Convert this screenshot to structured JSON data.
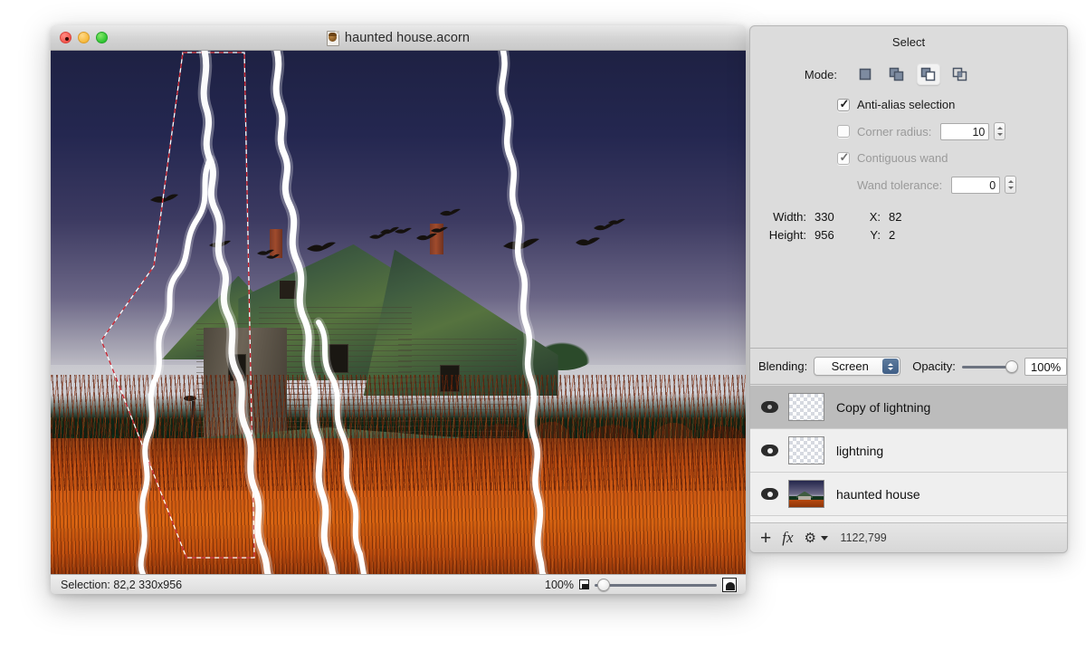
{
  "window": {
    "title": "haunted house.acorn",
    "doc_icon": "acorn-document-icon",
    "controls": {
      "close": "close-button",
      "minimize": "minimize-button",
      "zoom": "zoom-button"
    }
  },
  "statusbar": {
    "selection_text": "Selection: 82,2 330x956",
    "zoom_percent": "100%",
    "small_icon": "small-image-icon",
    "large_icon": "large-image-icon"
  },
  "inspector": {
    "title": "Select",
    "mode": {
      "label": "Mode:",
      "options": [
        {
          "name": "new-selection",
          "selected": false
        },
        {
          "name": "add-to-selection",
          "selected": false
        },
        {
          "name": "subtract-from-selection",
          "selected": true
        },
        {
          "name": "intersect-selection",
          "selected": false
        }
      ]
    },
    "antialias": {
      "label": "Anti-alias selection",
      "checked": true,
      "enabled": true
    },
    "corner_radius": {
      "label": "Corner radius:",
      "checked": false,
      "enabled": false,
      "value": "10"
    },
    "contiguous_wand": {
      "label": "Contiguous wand",
      "checked": true,
      "enabled": false
    },
    "wand_tolerance": {
      "label": "Wand tolerance:",
      "enabled": false,
      "value": "0"
    },
    "dimensions": {
      "width_label": "Width:",
      "width_value": "330",
      "height_label": "Height:",
      "height_value": "956",
      "x_label": "X:",
      "x_value": "82",
      "y_label": "Y:",
      "y_value": "2"
    }
  },
  "layers_panel": {
    "blending_label": "Blending:",
    "blending_value": "Screen",
    "opacity_label": "Opacity:",
    "opacity_value": "100%",
    "layers": [
      {
        "name": "Copy of lightning",
        "visible": true,
        "selected": true,
        "thumb": "transparent"
      },
      {
        "name": "lightning",
        "visible": true,
        "selected": false,
        "thumb": "transparent"
      },
      {
        "name": "haunted house",
        "visible": true,
        "selected": false,
        "thumb": "image"
      }
    ],
    "toolbar": {
      "add": "+",
      "fx": "fx",
      "gear": "⚙",
      "memory": "1122,799"
    }
  },
  "colors": {
    "panel_bg": "#dcdcdc",
    "selected_layer": "#bcbcbc",
    "lightning": "#ffffff",
    "marquee_red": "#c81e2a",
    "sky_top": "#1e2143",
    "field": "#cf5a12"
  }
}
